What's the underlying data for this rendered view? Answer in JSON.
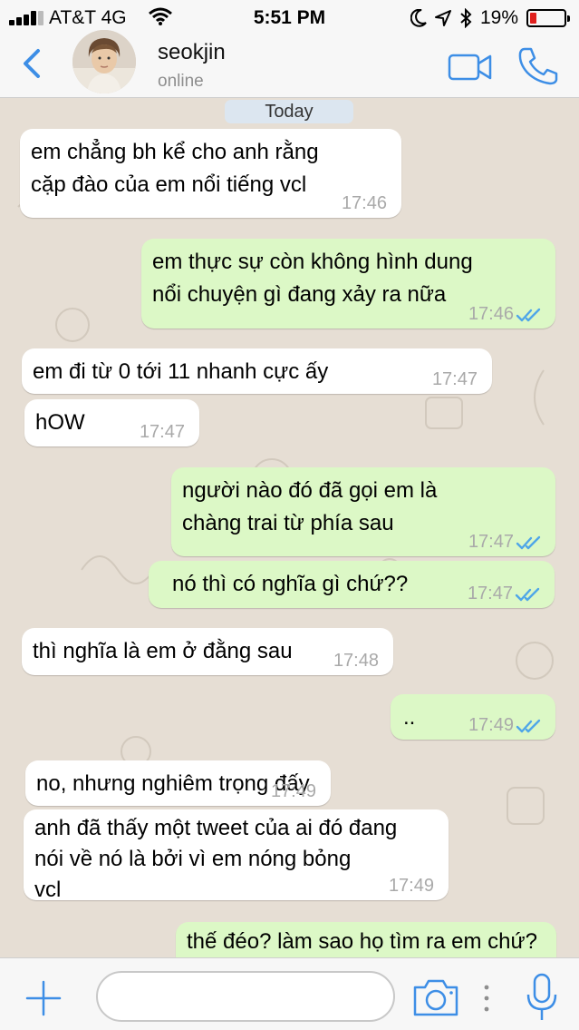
{
  "status_bar": {
    "carrier": "AT&T 4G",
    "time": "5:51 PM",
    "battery_percent": "19%",
    "battery_level": 0.19,
    "icons": [
      "signal-bars-icon",
      "wifi-icon",
      "moon-icon",
      "location-arrow-icon",
      "bluetooth-icon",
      "battery-icon"
    ]
  },
  "header": {
    "back_icon": "chevron-left-icon",
    "contact_name": "seokjin",
    "contact_status": "online",
    "video_icon": "video-camera-icon",
    "call_icon": "phone-icon"
  },
  "date_separator": "Today",
  "messages": [
    {
      "direction": "in",
      "lines": [
        "em chẳng bh kể cho anh rằng",
        "cặp đào của em nổi tiếng vcl"
      ],
      "time": "17:46"
    },
    {
      "direction": "out",
      "lines": [
        "em thực sự còn không hình dung",
        "nổi chuyện gì đang xảy ra nữa"
      ],
      "time": "17:46",
      "ticks": "read-double-tick-icon"
    },
    {
      "direction": "in",
      "lines": [
        "em đi từ 0 tới 11 nhanh cực ấy"
      ],
      "time": "17:47"
    },
    {
      "direction": "in",
      "lines": [
        "hOW"
      ],
      "time": "17:47"
    },
    {
      "direction": "out",
      "lines": [
        "người nào đó đã gọi em là",
        "chàng trai từ phía sau"
      ],
      "time": "17:47",
      "ticks": "read-double-tick-icon"
    },
    {
      "direction": "out",
      "lines": [
        "nó thì có nghĩa gì chứ??"
      ],
      "time": "17:47",
      "ticks": "read-double-tick-icon"
    },
    {
      "direction": "in",
      "lines": [
        "thì nghĩa là em ở đằng sau"
      ],
      "time": "17:48"
    },
    {
      "direction": "out",
      "lines": [
        ".."
      ],
      "time": "17:49",
      "ticks": "read-double-tick-icon"
    },
    {
      "direction": "in",
      "lines": [
        "no, nhưng nghiêm trọng đấy"
      ],
      "time": "17:49"
    },
    {
      "direction": "in",
      "lines": [
        "anh đã thấy một tweet của ai đó đang",
        "nói về nó là bởi vì em nóng bỏng",
        "vcl"
      ],
      "time": "17:49"
    },
    {
      "direction": "out",
      "lines": [
        "thế đéo? làm sao họ tìm ra em chứ?"
      ],
      "time": "",
      "ticks": ""
    }
  ],
  "composer": {
    "add_icon": "plus-icon",
    "input_value": "",
    "camera_icon": "camera-icon",
    "mic_icon": "microphone-icon"
  },
  "colors": {
    "chat_background": "#e6ded4",
    "incoming_bubble": "#ffffff",
    "outgoing_bubble": "#dcf8c6",
    "accent_blue": "#3d8ee6",
    "read_ticks": "#4fa6e8",
    "battery_low": "#e0201e"
  }
}
